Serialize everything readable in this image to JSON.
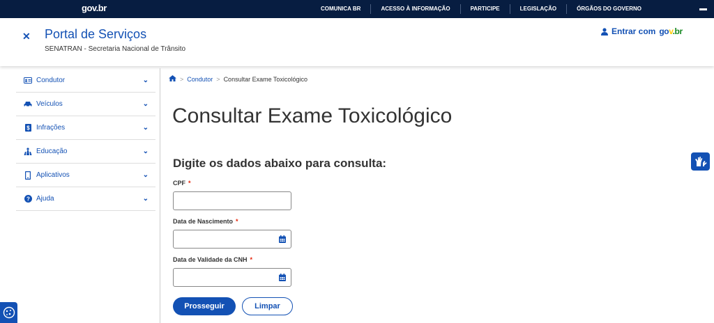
{
  "govbar": {
    "logo": "gov.br",
    "links": [
      "COMUNICA BR",
      "ACESSO À INFORMAÇÃO",
      "PARTICIPE",
      "LEGISLAÇÃO",
      "ÓRGÃOS DO GOVERNO"
    ]
  },
  "header": {
    "title": "Portal de Serviços",
    "subtitle": "SENATRAN - Secretaria Nacional de Trânsito",
    "login_text": "Entrar com",
    "login_logo_g": "go",
    "login_logo_v": "v",
    "login_logo_br": ".br"
  },
  "sidebar": {
    "items": [
      {
        "label": "Condutor",
        "icon": "id-card-icon"
      },
      {
        "label": "Veículos",
        "icon": "car-icon"
      },
      {
        "label": "Infrações",
        "icon": "ticket-icon"
      },
      {
        "label": "Educação",
        "icon": "people-icon"
      },
      {
        "label": "Aplicativos",
        "icon": "mobile-icon"
      },
      {
        "label": "Ajuda",
        "icon": "question-icon"
      }
    ]
  },
  "breadcrumb": {
    "link": "Condutor",
    "current": "Consultar Exame Toxicológico"
  },
  "page": {
    "title": "Consultar Exame Toxicológico",
    "form_heading": "Digite os dados abaixo para consulta:"
  },
  "form": {
    "cpf_label": "CPF",
    "birth_label": "Data de Nascimento",
    "cnh_label": "Data de Validade da CNH",
    "required_mark": "*",
    "submit_label": "Prosseguir",
    "clear_label": "Limpar"
  },
  "colors": {
    "primary": "#1351b4",
    "govbar": "#071d41",
    "required": "#e52207"
  }
}
